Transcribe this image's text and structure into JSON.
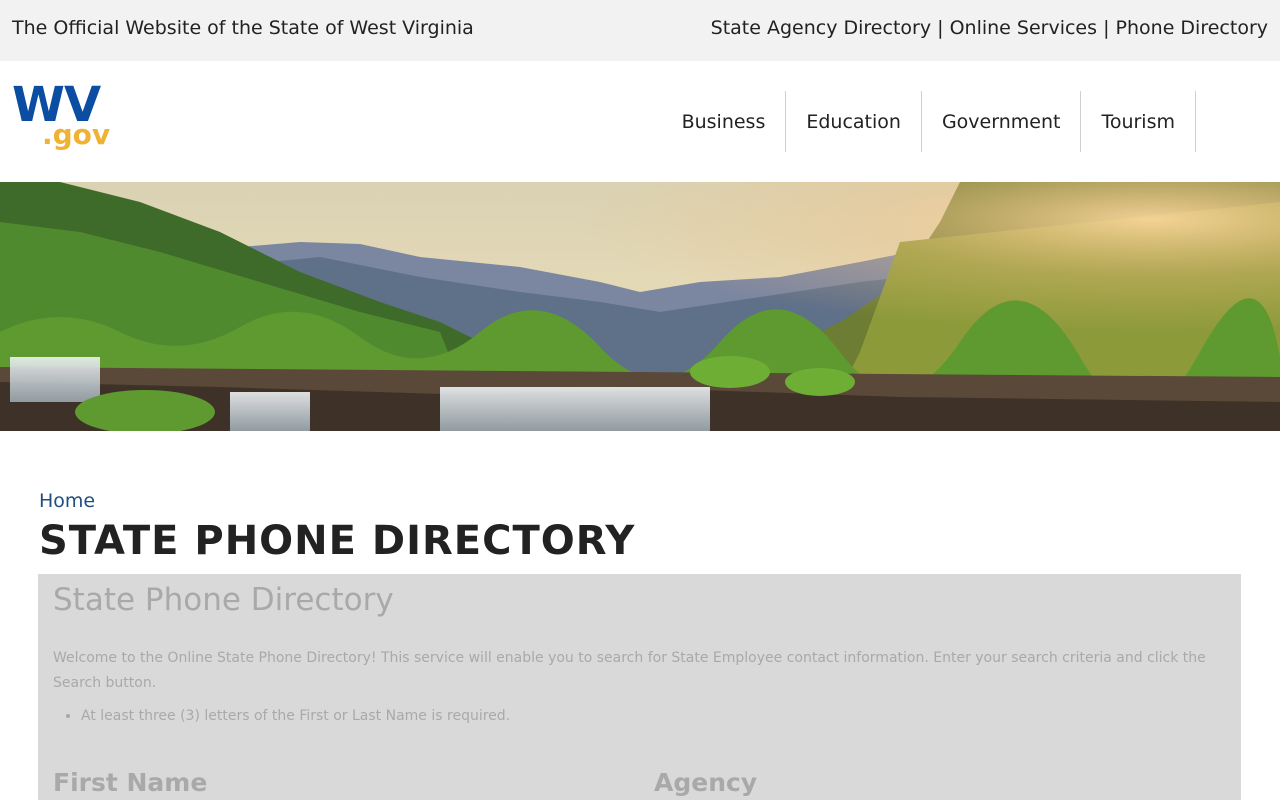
{
  "topbar": {
    "site_title": "The Official Website of the State of West Virginia",
    "links": [
      "State Agency Directory",
      "Online Services",
      "Phone Directory"
    ],
    "separator": "|"
  },
  "logo": {
    "primary": "WV",
    "secondary": ".gov"
  },
  "nav": {
    "items": [
      "Business",
      "Education",
      "Government",
      "Tourism"
    ]
  },
  "hero": {
    "image": "mountain-waterfall-landscape"
  },
  "breadcrumb": {
    "home": "Home"
  },
  "page": {
    "title": "STATE PHONE DIRECTORY"
  },
  "panel": {
    "title": "State Phone Directory",
    "intro": "Welcome to the Online State Phone Directory! This service will enable you to search for State Employee contact information. Enter your search criteria and click the Search button.",
    "bullets": [
      "At least three (3) letters of the First or Last Name is required."
    ],
    "first_name_label": "First Name",
    "agency_label": "Agency"
  },
  "colors": {
    "brand_blue": "#0a4da2",
    "brand_gold": "#f0b232",
    "link_blue": "#1f4f82",
    "topbar_bg": "#f2f2f2",
    "panel_bg": "#d9d9d9"
  }
}
